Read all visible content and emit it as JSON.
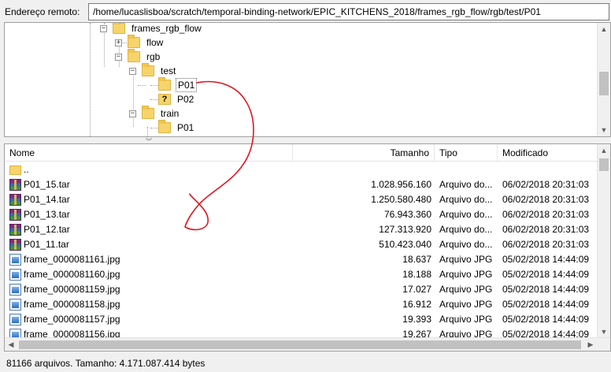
{
  "path_bar": {
    "label": "Endereço remoto:",
    "value": "/home/lucaslisboa/scratch/temporal-binding-network/EPIC_KITCHENS_2018/frames_rgb_flow/rgb/test/P01"
  },
  "tree": {
    "nodes": [
      {
        "label": "frames_rgb_flow",
        "expander": "−",
        "icon": "folder-icon"
      },
      {
        "label": "flow",
        "expander": "+",
        "icon": "folder-icon"
      },
      {
        "label": "rgb",
        "expander": "−",
        "icon": "folder-icon"
      },
      {
        "label": "test",
        "expander": "−",
        "icon": "folder-icon"
      },
      {
        "label": "P01",
        "expander": "",
        "icon": "folder-icon"
      },
      {
        "label": "P02",
        "expander": "",
        "icon": "unknown-folder-icon",
        "glyph": "?"
      },
      {
        "label": "train",
        "expander": "−",
        "icon": "folder-icon"
      },
      {
        "label": "P01",
        "expander": "",
        "icon": "folder-icon"
      }
    ]
  },
  "list": {
    "columns": [
      "Nome",
      "Tamanho",
      "Tipo",
      "Modificado"
    ],
    "rows": [
      {
        "name": "..",
        "size": "",
        "type": "",
        "modified": "",
        "icon": "folder"
      },
      {
        "name": "P01_15.tar",
        "size": "1.028.956.160",
        "type": "Arquivo do...",
        "modified": "06/02/2018 20:31:03",
        "icon": "rar"
      },
      {
        "name": "P01_14.tar",
        "size": "1.250.580.480",
        "type": "Arquivo do...",
        "modified": "06/02/2018 20:31:03",
        "icon": "rar"
      },
      {
        "name": "P01_13.tar",
        "size": "76.943.360",
        "type": "Arquivo do...",
        "modified": "06/02/2018 20:31:03",
        "icon": "rar"
      },
      {
        "name": "P01_12.tar",
        "size": "127.313.920",
        "type": "Arquivo do...",
        "modified": "06/02/2018 20:31:03",
        "icon": "rar"
      },
      {
        "name": "P01_11.tar",
        "size": "510.423.040",
        "type": "Arquivo do...",
        "modified": "06/02/2018 20:31:03",
        "icon": "rar"
      },
      {
        "name": "frame_0000081161.jpg",
        "size": "18.637",
        "type": "Arquivo JPG",
        "modified": "05/02/2018 14:44:09",
        "icon": "jpg"
      },
      {
        "name": "frame_0000081160.jpg",
        "size": "18.188",
        "type": "Arquivo JPG",
        "modified": "05/02/2018 14:44:09",
        "icon": "jpg"
      },
      {
        "name": "frame_0000081159.jpg",
        "size": "17.027",
        "type": "Arquivo JPG",
        "modified": "05/02/2018 14:44:09",
        "icon": "jpg"
      },
      {
        "name": "frame_0000081158.jpg",
        "size": "16.912",
        "type": "Arquivo JPG",
        "modified": "05/02/2018 14:44:09",
        "icon": "jpg"
      },
      {
        "name": "frame_0000081157.jpg",
        "size": "19.393",
        "type": "Arquivo JPG",
        "modified": "05/02/2018 14:44:09",
        "icon": "jpg"
      },
      {
        "name": "frame_0000081156.jpg",
        "size": "19.267",
        "type": "Arquivo JPG",
        "modified": "05/02/2018 14:44:09",
        "icon": "jpg"
      }
    ]
  },
  "status": {
    "text": "81166 arquivos. Tamanho: 4.171.087.414 bytes"
  },
  "colors": {
    "annotation": "#e0141e",
    "folder": "#f6d46b"
  }
}
